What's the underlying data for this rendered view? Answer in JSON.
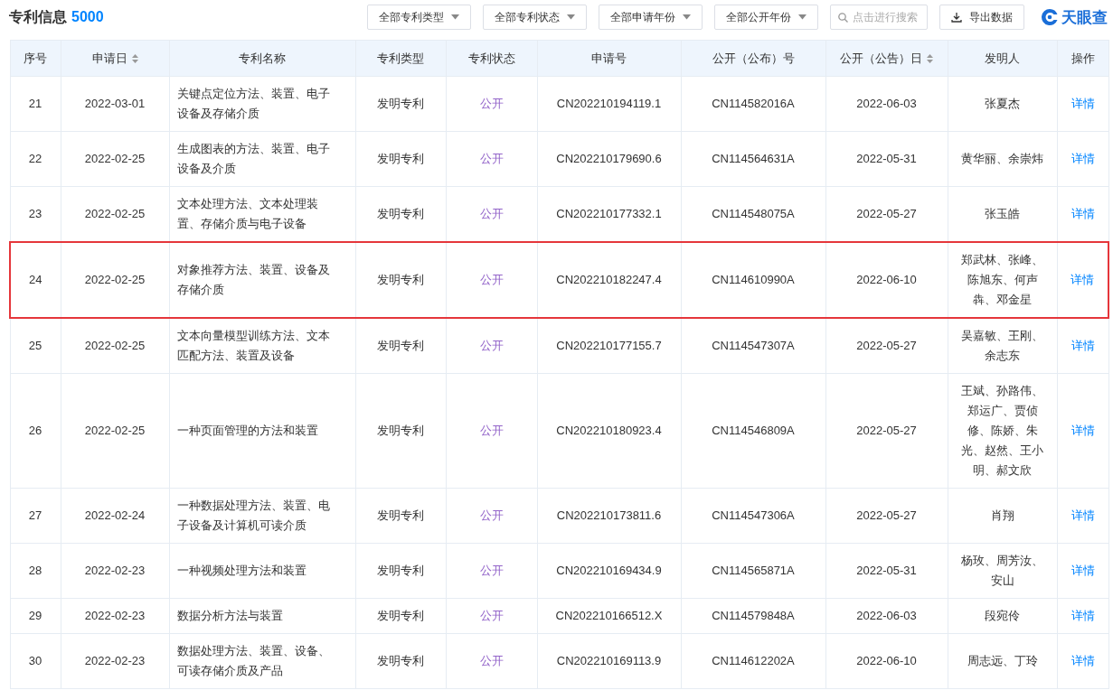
{
  "header": {
    "title": "专利信息",
    "count": "5000",
    "filters": [
      {
        "label": "全部专利类型"
      },
      {
        "label": "全部专利状态"
      },
      {
        "label": "全部申请年份"
      },
      {
        "label": "全部公开年份"
      }
    ],
    "search": {
      "placeholder": "点击进行搜索"
    },
    "export_button": "导出数据",
    "logo": "天眼查"
  },
  "table": {
    "columns": [
      {
        "label": "序号",
        "sortable": false
      },
      {
        "label": "申请日",
        "sortable": true
      },
      {
        "label": "专利名称",
        "sortable": false
      },
      {
        "label": "专利类型",
        "sortable": false
      },
      {
        "label": "专利状态",
        "sortable": false
      },
      {
        "label": "申请号",
        "sortable": false
      },
      {
        "label": "公开（公布）号",
        "sortable": false
      },
      {
        "label": "公开（公告）日",
        "sortable": true
      },
      {
        "label": "发明人",
        "sortable": false
      },
      {
        "label": "操作",
        "sortable": false
      }
    ],
    "rows": [
      {
        "no": "21",
        "filing_date": "2022-03-01",
        "title": "关键点定位方法、装置、电子设备及存储介质",
        "type": "发明专利",
        "status": "公开",
        "application_no": "CN202210194119.1",
        "publication_no": "CN114582016A",
        "publication_date": "2022-06-03",
        "inventors": "张夏杰",
        "action": "详情",
        "highlighted": false
      },
      {
        "no": "22",
        "filing_date": "2022-02-25",
        "title": "生成图表的方法、装置、电子设备及介质",
        "type": "发明专利",
        "status": "公开",
        "application_no": "CN202210179690.6",
        "publication_no": "CN114564631A",
        "publication_date": "2022-05-31",
        "inventors": "黄华丽、余崇炜",
        "action": "详情",
        "highlighted": false
      },
      {
        "no": "23",
        "filing_date": "2022-02-25",
        "title": "文本处理方法、文本处理装置、存储介质与电子设备",
        "type": "发明专利",
        "status": "公开",
        "application_no": "CN202210177332.1",
        "publication_no": "CN114548075A",
        "publication_date": "2022-05-27",
        "inventors": "张玉皓",
        "action": "详情",
        "highlighted": false
      },
      {
        "no": "24",
        "filing_date": "2022-02-25",
        "title": "对象推荐方法、装置、设备及存储介质",
        "type": "发明专利",
        "status": "公开",
        "application_no": "CN202210182247.4",
        "publication_no": "CN114610990A",
        "publication_date": "2022-06-10",
        "inventors": "郑武林、张峰、陈旭东、何声犇、邓金星",
        "action": "详情",
        "highlighted": true
      },
      {
        "no": "25",
        "filing_date": "2022-02-25",
        "title": "文本向量模型训练方法、文本匹配方法、装置及设备",
        "type": "发明专利",
        "status": "公开",
        "application_no": "CN202210177155.7",
        "publication_no": "CN114547307A",
        "publication_date": "2022-05-27",
        "inventors": "吴嘉敏、王刚、余志东",
        "action": "详情",
        "highlighted": false
      },
      {
        "no": "26",
        "filing_date": "2022-02-25",
        "title": "一种页面管理的方法和装置",
        "type": "发明专利",
        "status": "公开",
        "application_no": "CN202210180923.4",
        "publication_no": "CN114546809A",
        "publication_date": "2022-05-27",
        "inventors": "王斌、孙路伟、郑运广、贾侦修、陈娇、朱光、赵然、王小明、郝文欣",
        "action": "详情",
        "highlighted": false
      },
      {
        "no": "27",
        "filing_date": "2022-02-24",
        "title": "一种数据处理方法、装置、电子设备及计算机可读介质",
        "type": "发明专利",
        "status": "公开",
        "application_no": "CN202210173811.6",
        "publication_no": "CN114547306A",
        "publication_date": "2022-05-27",
        "inventors": "肖翔",
        "action": "详情",
        "highlighted": false
      },
      {
        "no": "28",
        "filing_date": "2022-02-23",
        "title": "一种视频处理方法和装置",
        "type": "发明专利",
        "status": "公开",
        "application_no": "CN202210169434.9",
        "publication_no": "CN114565871A",
        "publication_date": "2022-05-31",
        "inventors": "杨玫、周芳汝、安山",
        "action": "详情",
        "highlighted": false
      },
      {
        "no": "29",
        "filing_date": "2022-02-23",
        "title": "数据分析方法与装置",
        "type": "发明专利",
        "status": "公开",
        "application_no": "CN202210166512.X",
        "publication_no": "CN114579848A",
        "publication_date": "2022-06-03",
        "inventors": "段宛伶",
        "action": "详情",
        "highlighted": false
      },
      {
        "no": "30",
        "filing_date": "2022-02-23",
        "title": "数据处理方法、装置、设备、可读存储介质及产品",
        "type": "发明专利",
        "status": "公开",
        "application_no": "CN202210169113.9",
        "publication_no": "CN114612202A",
        "publication_date": "2022-06-10",
        "inventors": "周志远、丁玲",
        "action": "详情",
        "highlighted": false
      }
    ]
  }
}
